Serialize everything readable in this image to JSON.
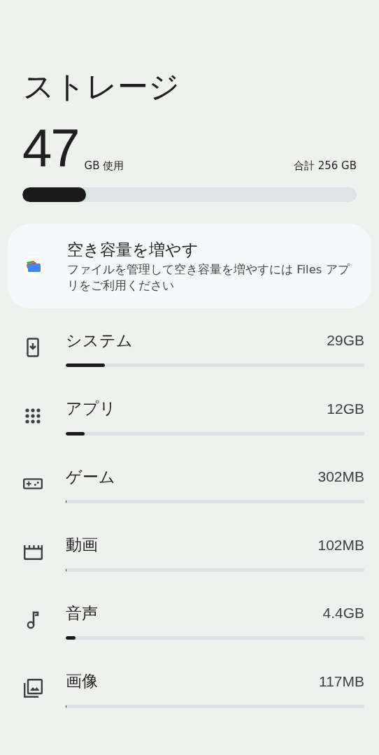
{
  "title": "ストレージ",
  "usage": {
    "amount": "47",
    "unit": "GB 使用",
    "total": "合計 256 GB",
    "level": 0.19
  },
  "card": {
    "title": "空き容量を増やす",
    "description": "ファイルを管理して空き容量を増やすには Files アプリをご利用ください"
  },
  "categories": [
    {
      "kind": "system",
      "label": "システム",
      "size": "29GB",
      "level": 0.13
    },
    {
      "kind": "apps",
      "label": "アプリ",
      "size": "12GB",
      "level": 0.063
    },
    {
      "kind": "games",
      "label": "ゲーム",
      "size": "302MB",
      "level": 0.003
    },
    {
      "kind": "video",
      "label": "動画",
      "size": "102MB",
      "level": 0.003
    },
    {
      "kind": "audio",
      "label": "音声",
      "size": "4.4GB",
      "level": 0.033
    },
    {
      "kind": "images",
      "label": "画像",
      "size": "117MB",
      "level": 0.003
    }
  ]
}
